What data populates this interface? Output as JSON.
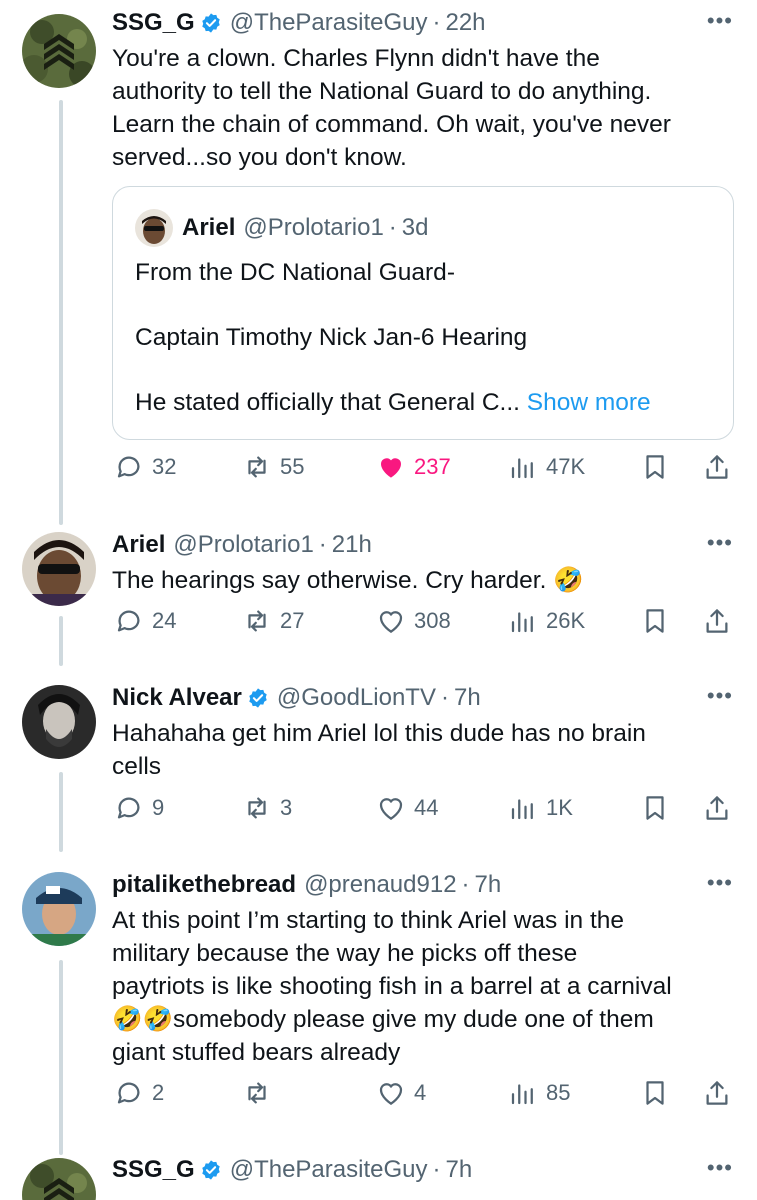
{
  "tweets": [
    {
      "name": "SSG_G",
      "handle": "@TheParasiteGuy",
      "time": "22h",
      "verified": true,
      "text_lines": [
        "You're a clown. Charles Flynn didn't have the",
        "authority to tell the National Guard to do anything.",
        "Learn the chain of command. Oh wait, you've never",
        "served...so you don't know."
      ],
      "quote": {
        "name": "Ariel",
        "handle": "@Prolotario1",
        "time": "3d",
        "line1": "From the DC National Guard-",
        "line2": "Captain Timothy Nick Jan-6 Hearing",
        "line3": "He stated officially that General C...",
        "show_more": "Show more"
      },
      "replies": "32",
      "reposts": "55",
      "likes": "237",
      "liked": true,
      "views": "47K"
    },
    {
      "name": "Ariel",
      "handle": "@Prolotario1",
      "time": "21h",
      "verified": false,
      "text_lines": [
        "The hearings say otherwise. Cry harder. 🤣"
      ],
      "replies": "24",
      "reposts": "27",
      "likes": "308",
      "liked": false,
      "views": "26K"
    },
    {
      "name": "Nick Alvear",
      "handle": "@GoodLionTV",
      "time": "7h",
      "verified": true,
      "text_lines": [
        "Hahahaha get him Ariel lol this dude has no brain",
        "cells"
      ],
      "replies": "9",
      "reposts": "3",
      "likes": "44",
      "liked": false,
      "views": "1K"
    },
    {
      "name": "pitalikethebread",
      "handle": "@prenaud912",
      "time": "7h",
      "verified": false,
      "text_lines": [
        "At this point I’m starting to think Ariel was in the",
        "military because the way he picks off these",
        "paytriots is like shooting fish in a barrel at a carnival",
        "🤣🤣somebody please give my dude one of them",
        "giant stuffed bears already"
      ],
      "replies": "2",
      "reposts": "",
      "likes": "4",
      "liked": false,
      "views": "85"
    },
    {
      "name": "SSG_G",
      "handle": "@TheParasiteGuy",
      "time": "7h",
      "verified": true
    }
  ],
  "separator": "·",
  "icons": {
    "more": "more-horizontal-icon",
    "verified": "verified-badge-icon",
    "reply": "reply-icon",
    "repost": "repost-icon",
    "like": "heart-icon",
    "views": "views-icon",
    "bookmark": "bookmark-icon",
    "share": "share-icon"
  },
  "colors": {
    "text": "#0f1419",
    "muted": "#536471",
    "verified": "#1d9bf0",
    "like_active": "#f91880",
    "link": "#1d9bf0",
    "border": "#cfd9de"
  }
}
